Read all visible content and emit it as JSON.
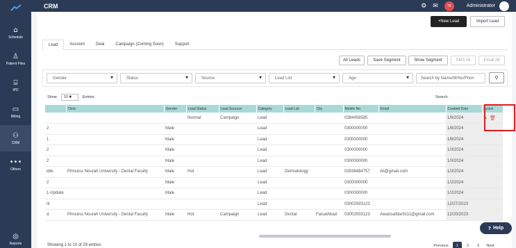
{
  "app": {
    "title": "CRM",
    "user": "Administrator",
    "notification_count": "76"
  },
  "sidebar": {
    "items": [
      {
        "label": "Schedule",
        "icon": "home-icon",
        "glyph": "⌂"
      },
      {
        "label": "Patient Files",
        "icon": "person-icon",
        "glyph": "♙"
      },
      {
        "label": "IPD",
        "icon": "bed-icon",
        "glyph": "⌸"
      },
      {
        "label": "Billing",
        "icon": "billing-icon",
        "glyph": "▭"
      },
      {
        "label": "CRM",
        "icon": "crm-icon",
        "glyph": "⚇"
      },
      {
        "label": "Others",
        "icon": "more-icon",
        "glyph": "•••"
      },
      {
        "label": "Reports",
        "icon": "reports-icon",
        "glyph": "◎"
      }
    ]
  },
  "actions": {
    "new_lead": "+New Lead",
    "import_lead": "Import Lead"
  },
  "tabs": [
    "Lead",
    "Account",
    "Deal",
    "Campaign (Coming Soon)",
    "Support"
  ],
  "toolbar": {
    "all_leads": "All Leads",
    "save_segment": "Save Segment",
    "show_segment": "Show Segment",
    "sms_all": "SMS All",
    "email_all": "Email All"
  },
  "filters": {
    "gender": "Gender",
    "status": "Status",
    "source": "Source",
    "lead_list": "Lead List",
    "age": "Age",
    "search_placeholder": "Search by Name/MrNo/Phon"
  },
  "entries": {
    "show": "Show",
    "count": "10",
    "entries": "Entries",
    "search": "Search:"
  },
  "table": {
    "headers": [
      "",
      "Clinic",
      "Gender",
      "Lead Status",
      "Lead Sources",
      "Category",
      "Lead List",
      "City",
      "Mobile No",
      "Email",
      "Created Date",
      "Action"
    ],
    "rows": [
      [
        "",
        "",
        "",
        "Normal",
        "Campaign",
        "Lead",
        "",
        "",
        "0384458585",
        "",
        "1/9/2024"
      ],
      [
        "2",
        "",
        "Male",
        "",
        "",
        "Lead",
        "",
        "",
        "0300000000",
        "",
        "1/8/2024"
      ],
      [
        "1",
        "",
        "Male",
        "",
        "",
        "Lead",
        "",
        "",
        "0300000000",
        "",
        "1/8/2024"
      ],
      [
        "2",
        "",
        "Male",
        "",
        "",
        "Lead",
        "",
        "",
        "0300000000",
        "",
        "1/3/2024"
      ],
      [
        "2",
        "",
        "Male",
        "",
        "",
        "Lead",
        "",
        "",
        "0300000000",
        "",
        "1/3/2024"
      ],
      [
        "idte",
        "Princess Nourah University - Dental Faculty",
        "Male",
        "Hot",
        "",
        "Lead",
        "Dermatology",
        "",
        "03038484757",
        "Ali@gmail.com",
        "1/3/2024"
      ],
      [
        "2",
        "",
        "Male",
        "",
        "",
        "Lead",
        "",
        "",
        "0300000000",
        "",
        "1/2/2024"
      ],
      [
        "1-Update",
        "",
        "Male",
        "",
        "",
        "Lead",
        "",
        "",
        "0300000000",
        "",
        "1/2/2024"
      ],
      [
        "rk",
        "",
        "",
        "",
        "",
        "Lead",
        "",
        "",
        "03002933123",
        "",
        "12/27/2023"
      ],
      [
        "d",
        "Princess Nourah University - Dental Faculty",
        "Male",
        "Hot",
        "Campaign",
        "Lead",
        "Dental",
        "FaisalAbad",
        "03002933123",
        "Awaissafdar9111@gmail.com",
        "12/20/2023"
      ]
    ]
  },
  "footer": {
    "showing": "Showing 1 to 10 of 29 entries",
    "previous": "Previous",
    "pages": [
      "1",
      "2",
      "3"
    ],
    "next": "Next"
  },
  "help": "Help"
}
